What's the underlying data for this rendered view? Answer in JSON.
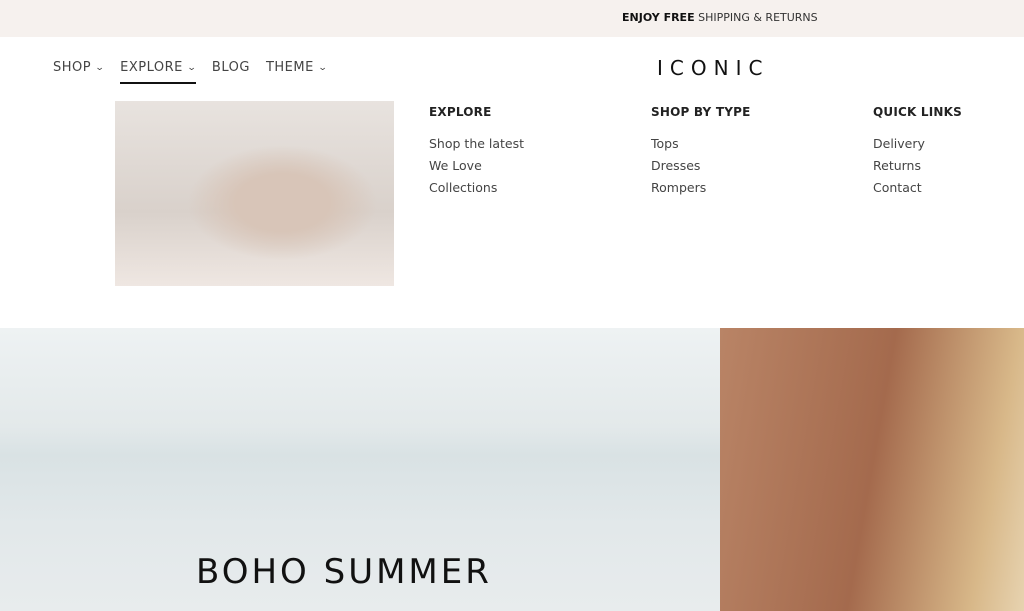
{
  "announcement": {
    "bold": "ENJOY FREE",
    "rest": " SHIPPING & RETURNS"
  },
  "nav": [
    {
      "label": "SHOP",
      "dropdown": true
    },
    {
      "label": "EXPLORE",
      "dropdown": true,
      "active": true
    },
    {
      "label": "BLOG",
      "dropdown": false
    },
    {
      "label": "THEME",
      "dropdown": true
    }
  ],
  "logo": "ICONIC",
  "mega_menu": {
    "columns": [
      {
        "title": "EXPLORE",
        "links": [
          "Shop the latest",
          "We Love",
          "Collections"
        ]
      },
      {
        "title": "SHOP BY TYPE",
        "links": [
          "Tops",
          "Dresses",
          "Rompers"
        ]
      },
      {
        "title": "QUICK LINKS",
        "links": [
          "Delivery",
          "Returns",
          "Contact"
        ]
      }
    ]
  },
  "hero": {
    "title": "BOHO SUMMER"
  }
}
